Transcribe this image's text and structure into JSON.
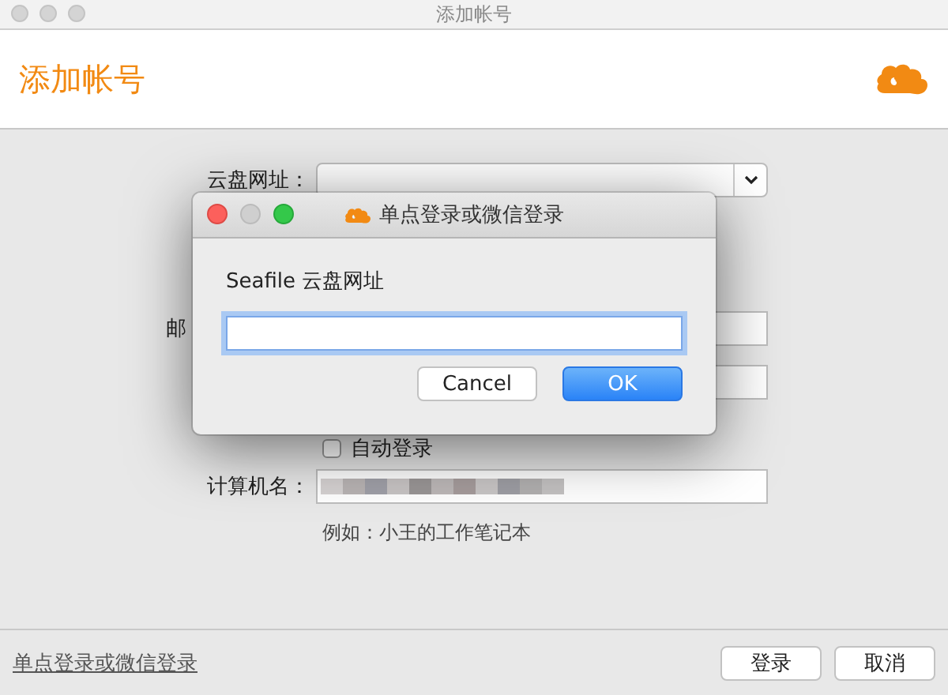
{
  "window": {
    "title": "添加帐号"
  },
  "header": {
    "title": "添加帐号"
  },
  "form": {
    "rows": [
      {
        "kind": "combo",
        "label": "云盘网址："
      },
      {
        "kind": "text",
        "label": "邮"
      },
      {
        "kind": "text",
        "label": ""
      },
      {
        "kind": "checkbox",
        "label": "自动登录",
        "checked": false
      },
      {
        "kind": "redacted",
        "label": "计算机名："
      }
    ],
    "hint": "例如：小王的工作笔记本"
  },
  "footer": {
    "link": "单点登录或微信登录",
    "buttons": [
      "登录",
      "取消"
    ]
  },
  "dialog": {
    "title": "单点登录或微信登录",
    "prompt": "Seafile 云盘网址",
    "buttons": [
      {
        "label": "Cancel",
        "kind": "normal"
      },
      {
        "label": "OK",
        "kind": "default"
      }
    ]
  }
}
